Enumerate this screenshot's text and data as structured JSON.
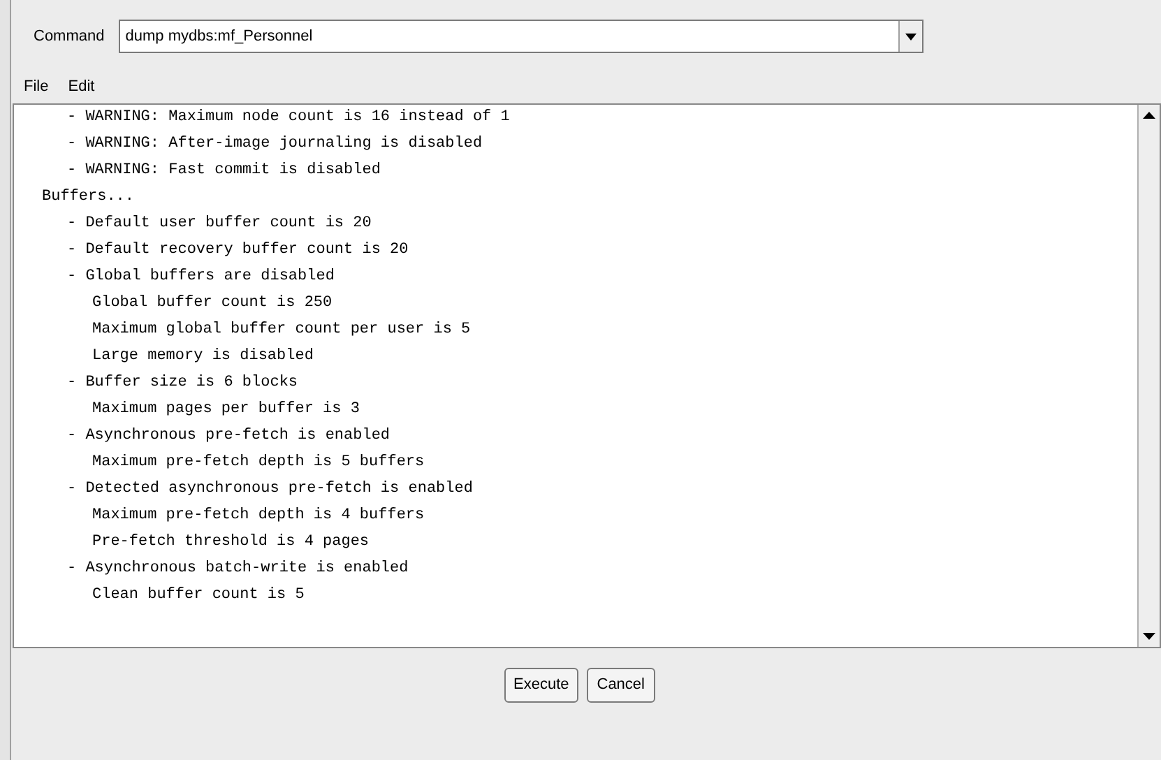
{
  "command": {
    "label": "Command",
    "value": "dump mydbs:mf_Personnel"
  },
  "menu": [
    {
      "label": "File"
    },
    {
      "label": "Edit"
    }
  ],
  "output": {
    "earlier_items": [
      {
        "text": "- WARNING: Maximum node count is 16 instead of 1"
      },
      {
        "text": "- WARNING: After-image journaling is disabled"
      },
      {
        "text": "- WARNING: Fast commit is disabled"
      }
    ],
    "sections": [
      {
        "text": "Buffers...",
        "children": [
          {
            "text": "- Default user buffer count is 20"
          },
          {
            "text": "- Default recovery buffer count is 20"
          },
          {
            "text": "- Global buffers are disabled",
            "children": [
              {
                "text": "Global buffer count is 250"
              },
              {
                "text": "Maximum global buffer count per user is 5"
              },
              {
                "text": "Large memory is disabled"
              }
            ]
          },
          {
            "text": "- Buffer size is 6 blocks",
            "children": [
              {
                "text": "Maximum pages per buffer is 3"
              }
            ]
          },
          {
            "text": "- Asynchronous pre-fetch is enabled",
            "children": [
              {
                "text": "Maximum pre-fetch depth is 5 buffers"
              }
            ]
          },
          {
            "text": "- Detected asynchronous pre-fetch is enabled",
            "children": [
              {
                "text": "Maximum pre-fetch depth is 4 buffers"
              },
              {
                "text": "Pre-fetch threshold is 4 pages"
              }
            ]
          },
          {
            "text": "- Asynchronous batch-write is enabled",
            "children": [
              {
                "text": "Clean buffer count is 5"
              }
            ]
          }
        ]
      }
    ]
  },
  "buttons": [
    {
      "label": "Execute"
    },
    {
      "label": "Cancel"
    }
  ]
}
